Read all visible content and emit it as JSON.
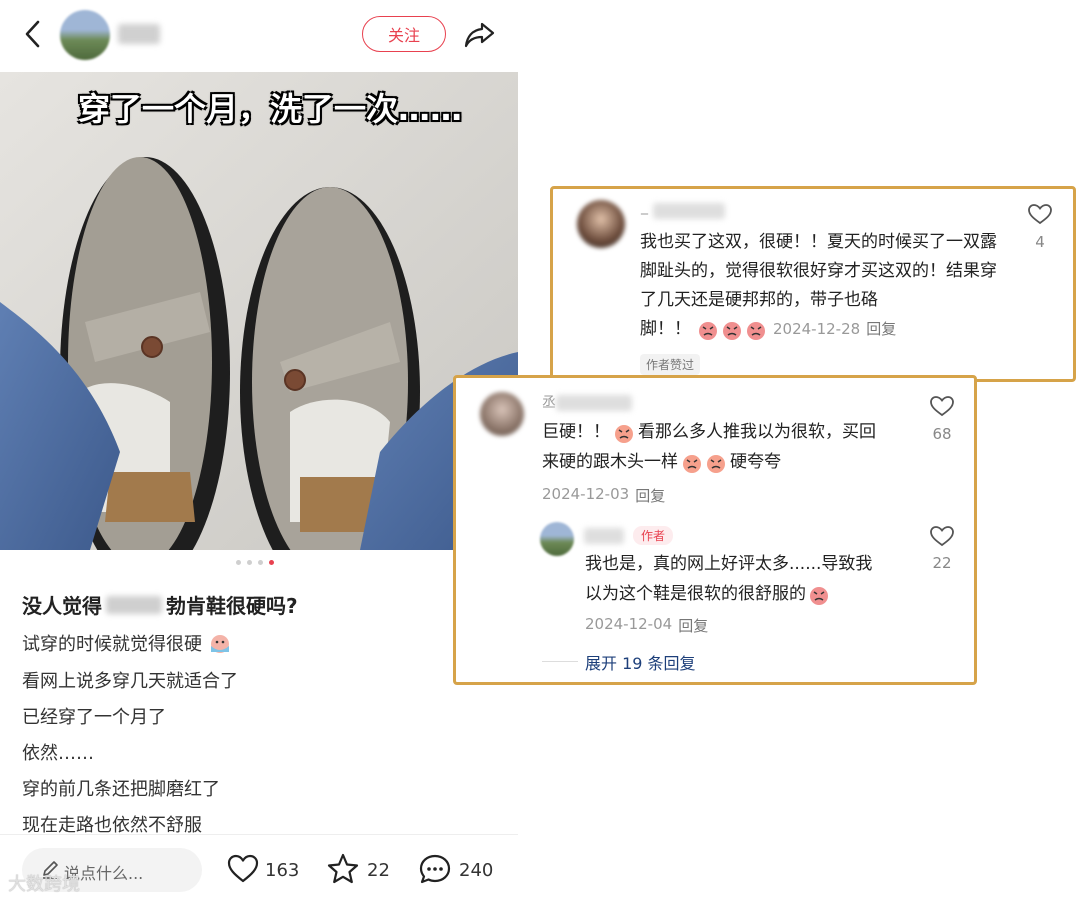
{
  "header": {
    "follow_label": "关注"
  },
  "post": {
    "image_caption": "穿了一个月，洗了一次……",
    "title_prefix": "没人觉得",
    "title_suffix": "勃肯鞋很硬吗?",
    "lines": [
      "试穿的时候就觉得很硬",
      "看网上说多穿几天就适合了",
      "已经穿了一个月了",
      "依然……",
      "穿的前几条还把脚磨红了",
      "现在走路也依然不舒服"
    ]
  },
  "bottom_bar": {
    "comment_placeholder": "说点什么...",
    "likes": "163",
    "favorites": "22",
    "comments": "240",
    "watermark": "大数跨境"
  },
  "comment1": {
    "name_prefix": "_",
    "text": "我也买了这双，很硬！！夏天的时候买了一双露脚趾头的，觉得很软很好穿才买这双的！结果穿了几天还是硬邦邦的，带子也硌",
    "text_tail": "脚！！",
    "date": "2024-12-28",
    "reply_label": "回复",
    "likes": "4",
    "author_liked": "作者赞过"
  },
  "comment2": {
    "name_prefix": "丞",
    "text_a": "巨硬！！",
    "text_b": "看那么多人推我以为很软，买回",
    "text_c": "来硬的跟木头一样",
    "text_d": "硬夸夸",
    "date": "2024-12-03",
    "reply_label": "回复",
    "likes": "68"
  },
  "reply1": {
    "author_tag": "作者",
    "line1": "我也是，真的网上好评太多......导致我",
    "line2": "以为这个鞋是很软的很舒服的",
    "date": "2024-12-04",
    "reply_label": "回复",
    "likes": "22"
  },
  "expand_label": "展开 19 条回复",
  "colors": {
    "accent": "#e8414f",
    "card_border": "#d6a349",
    "link_blue": "#1d3f7a"
  }
}
